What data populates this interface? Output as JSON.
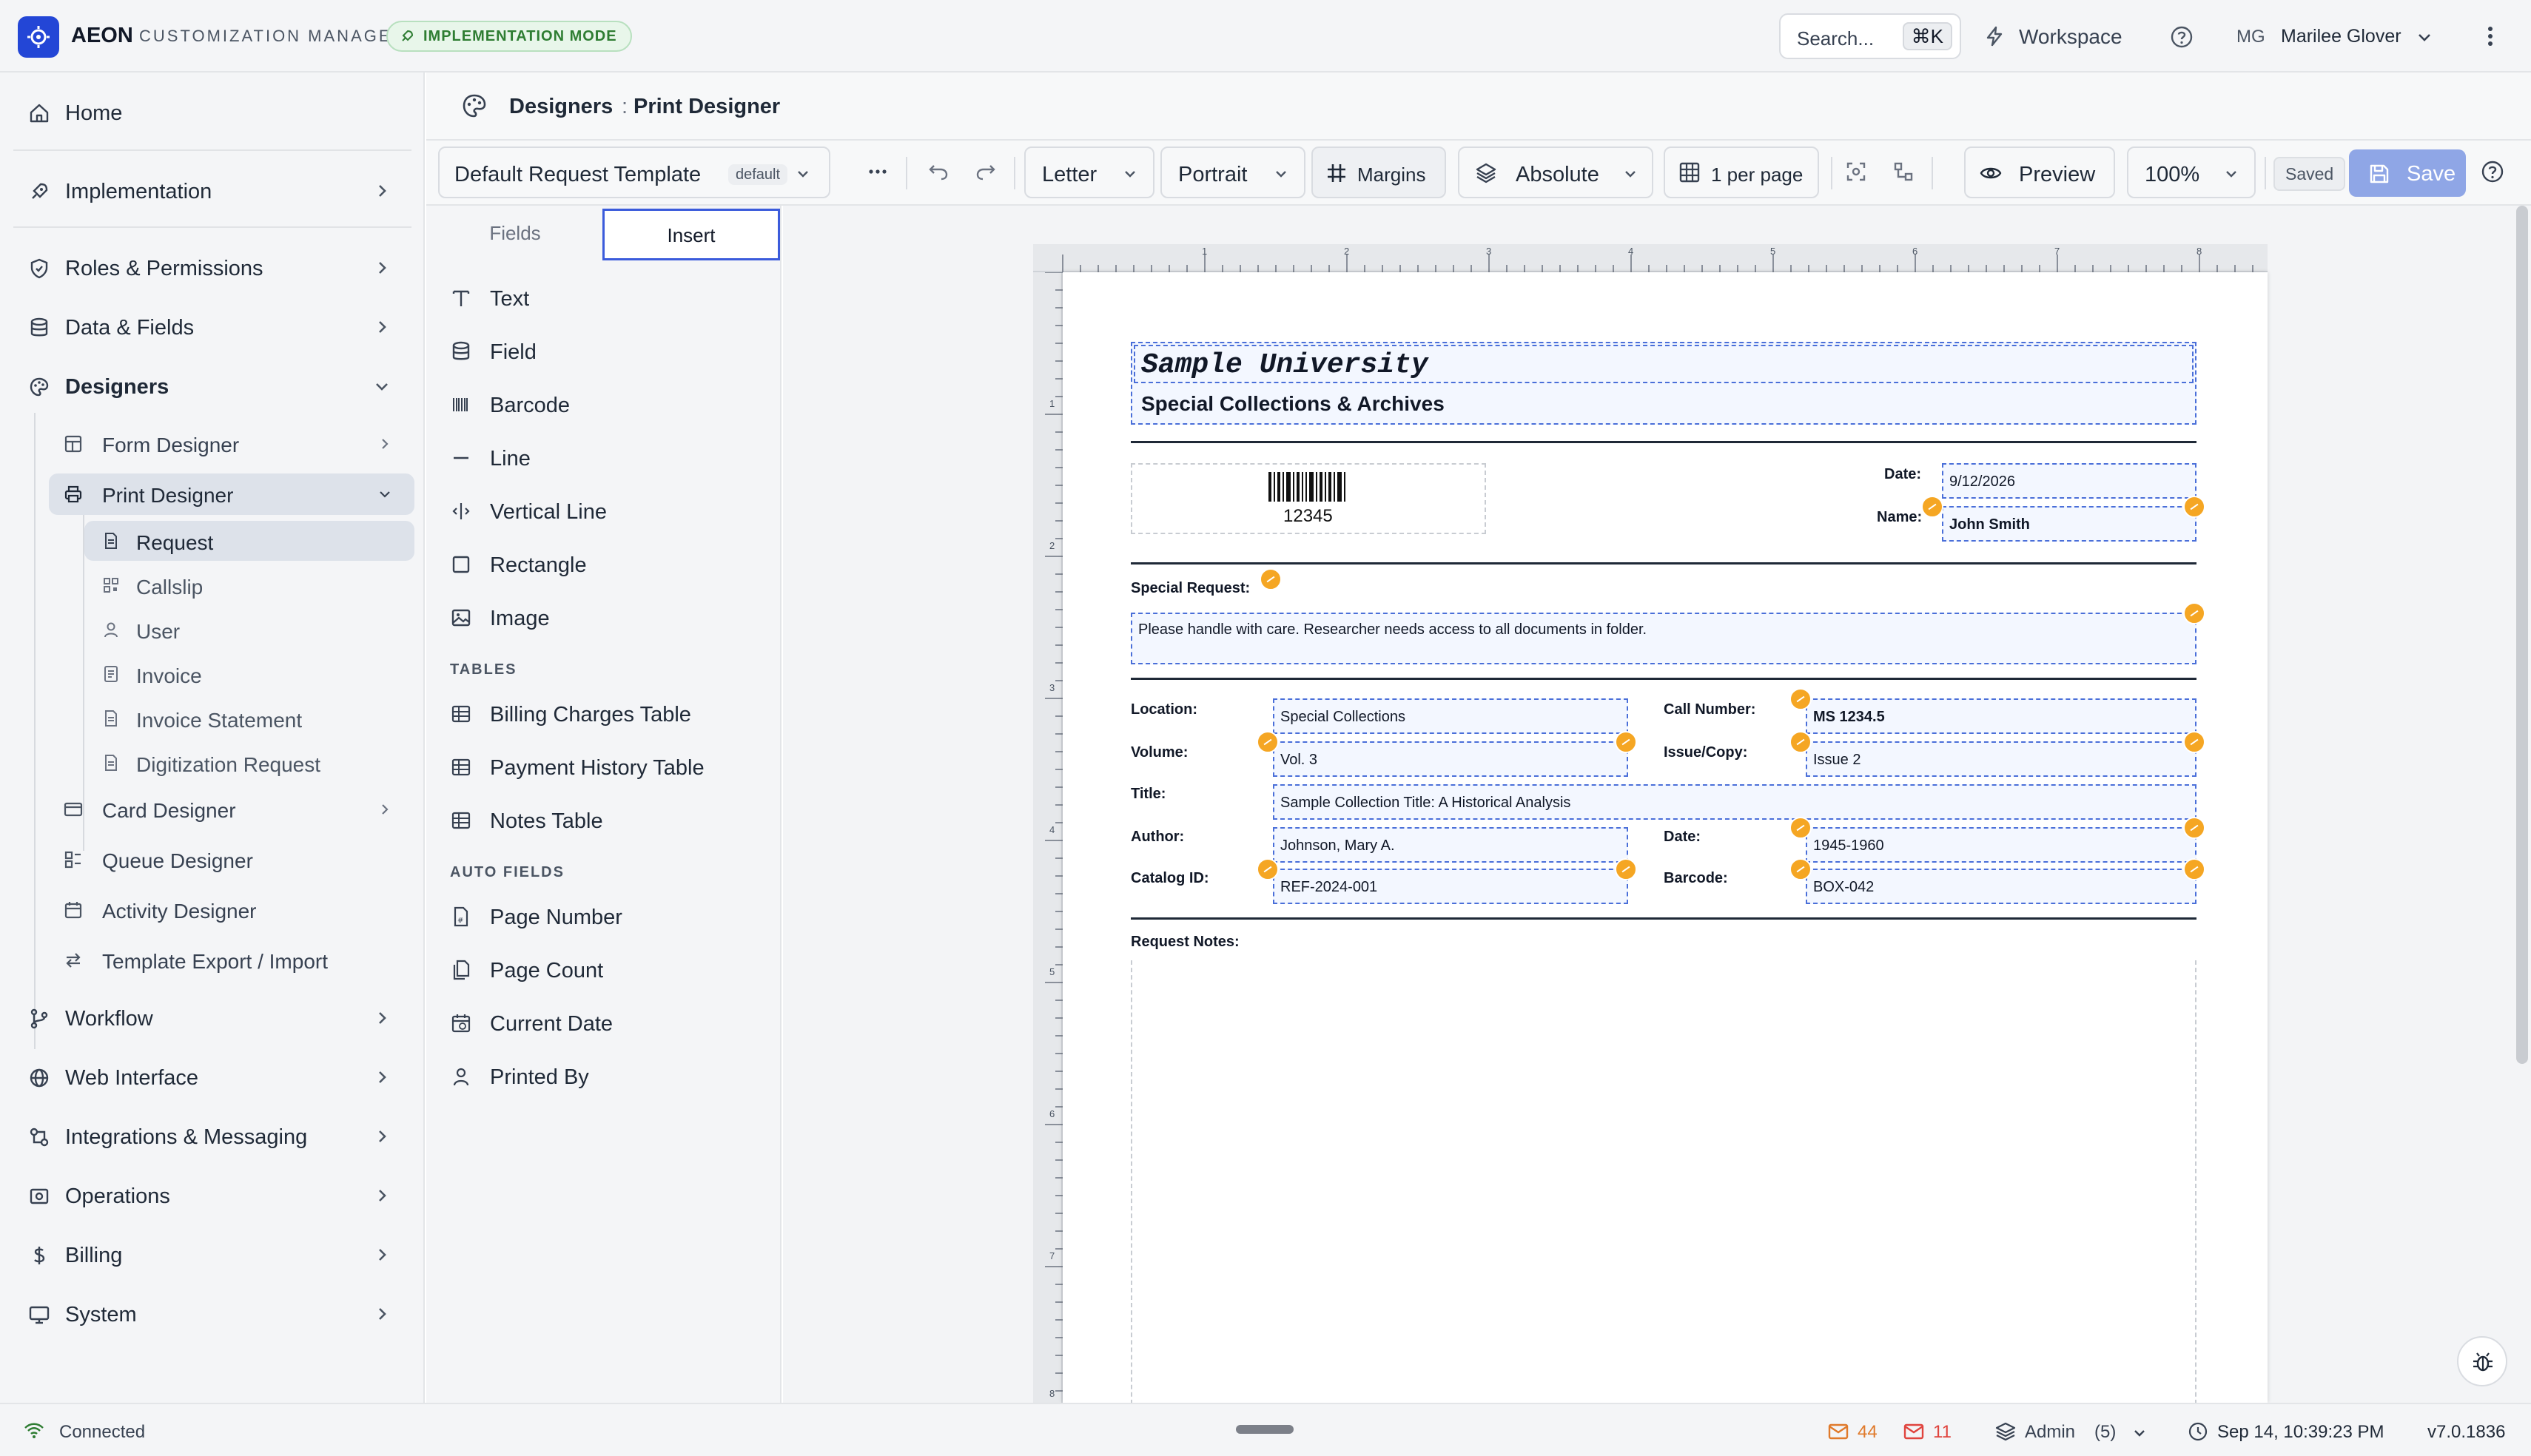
{
  "app": {
    "name": "AEON",
    "subtitle": "CUSTOMIZATION MANAGER",
    "mode_badge": "IMPLEMENTATION MODE",
    "search_label": "Search...",
    "search_shortcut": "⌘K",
    "workspace_label": "Workspace",
    "user_initials": "MG",
    "user_name": "Marilee Glover"
  },
  "sidebar": {
    "items": [
      {
        "label": "Home",
        "icon": "home-icon"
      },
      {
        "label": "Implementation",
        "icon": "rocket-icon"
      },
      {
        "label": "Roles & Permissions",
        "icon": "shield-icon"
      },
      {
        "label": "Data & Fields",
        "icon": "database-icon"
      },
      {
        "label": "Designers",
        "icon": "palette-icon"
      },
      {
        "label": "Workflow",
        "icon": "workflow-icon"
      },
      {
        "label": "Web Interface",
        "icon": "globe-icon"
      },
      {
        "label": "Integrations & Messaging",
        "icon": "integrations-icon"
      },
      {
        "label": "Operations",
        "icon": "operations-icon"
      },
      {
        "label": "Billing",
        "icon": "dollar-icon"
      },
      {
        "label": "System",
        "icon": "system-icon"
      }
    ],
    "designers_children": [
      {
        "label": "Form Designer"
      },
      {
        "label": "Print Designer"
      },
      {
        "label": "Card Designer"
      },
      {
        "label": "Queue Designer"
      },
      {
        "label": "Activity Designer"
      },
      {
        "label": "Template Export / Import"
      }
    ],
    "print_children": [
      {
        "label": "Request"
      },
      {
        "label": "Callslip"
      },
      {
        "label": "User"
      },
      {
        "label": "Invoice"
      },
      {
        "label": "Invoice Statement"
      },
      {
        "label": "Digitization Request"
      }
    ]
  },
  "breadcrumb": {
    "parent": "Designers",
    "separator": ":",
    "current": "Print Designer"
  },
  "toolbar": {
    "template": "Default Request Template",
    "template_badge": "default",
    "paper": "Letter",
    "orientation": "Portrait",
    "margins": "Margins",
    "positioning": "Absolute",
    "per_page": "1 per page",
    "preview": "Preview",
    "zoom": "100%",
    "saved": "Saved",
    "save": "Save"
  },
  "panel": {
    "tabs": [
      "Fields",
      "Insert"
    ],
    "active_tab": "Insert",
    "basic": [
      "Text",
      "Field",
      "Barcode",
      "Line",
      "Vertical Line",
      "Rectangle",
      "Image"
    ],
    "tables_heading": "TABLES",
    "tables": [
      "Billing Charges Table",
      "Payment History Table",
      "Notes Table"
    ],
    "auto_heading": "AUTO FIELDS",
    "auto": [
      "Page Number",
      "Page Count",
      "Current Date",
      "Printed By"
    ]
  },
  "rulers": {
    "top": [
      "1",
      "2",
      "3",
      "4",
      "5",
      "6",
      "7",
      "8"
    ],
    "left": [
      "1",
      "2",
      "3",
      "4",
      "5",
      "6",
      "7",
      "8"
    ]
  },
  "document": {
    "title": "Sample University",
    "subtitle": "Special Collections & Archives",
    "barcode_value": "12345",
    "date_label": "Date:",
    "date_value": "9/12/2026",
    "name_label": "Name:",
    "name_value": "John Smith",
    "special_request_label": "Special Request:",
    "special_request_value": "Please handle with care. Researcher needs access to all documents in folder.",
    "location_label": "Location:",
    "location_value": "Special Collections",
    "call_number_label": "Call Number:",
    "call_number_value": "MS 1234.5",
    "volume_label": "Volume:",
    "volume_value": "Vol. 3",
    "issue_label": "Issue/Copy:",
    "issue_value": "Issue 2",
    "title_label": "Title:",
    "title_value": "Sample Collection Title: A Historical Analysis",
    "author_label": "Author:",
    "author_value": "Johnson, Mary A.",
    "date2_label": "Date:",
    "date2_value": "1945-1960",
    "catalog_label": "Catalog ID:",
    "catalog_value": "REF-2024-001",
    "barcode_label": "Barcode:",
    "barcode_field_value": "BOX-042",
    "notes_label": "Request Notes:"
  },
  "status": {
    "connection": "Connected",
    "unread_count": "44",
    "alert_count": "11",
    "role": "Admin",
    "role_count": "(5)",
    "datetime": "Sep 14, 10:39:23 PM",
    "version": "v7.0.1836"
  },
  "colors": {
    "accent": "#2346d6",
    "save": "#8fa6e6",
    "badge": "#f5a623",
    "alert": "#e0443e",
    "mail": "#e07a2b"
  }
}
